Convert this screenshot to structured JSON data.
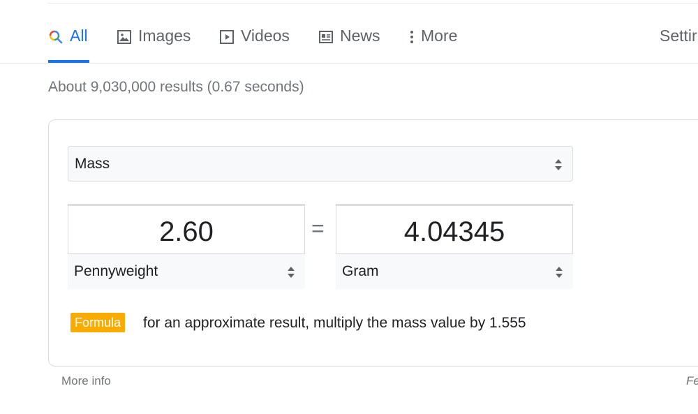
{
  "tabs": {
    "all": "All",
    "images": "Images",
    "videos": "Videos",
    "news": "News",
    "more": "More",
    "settings": "Settir"
  },
  "stats": "About 9,030,000 results (0.67 seconds)",
  "converter": {
    "category": "Mass",
    "from_value": "2.60",
    "from_unit": "Pennyweight",
    "equals": "=",
    "to_value": "4.04345",
    "to_unit": "Gram",
    "formula_label": "Formula",
    "formula_text": "for an approximate result, multiply the mass value by 1.555"
  },
  "footer": {
    "more_info": "More info",
    "feedback": "Fe"
  },
  "colors": {
    "accent": "#1a73e8",
    "formula_badge": "#f9ab00"
  }
}
